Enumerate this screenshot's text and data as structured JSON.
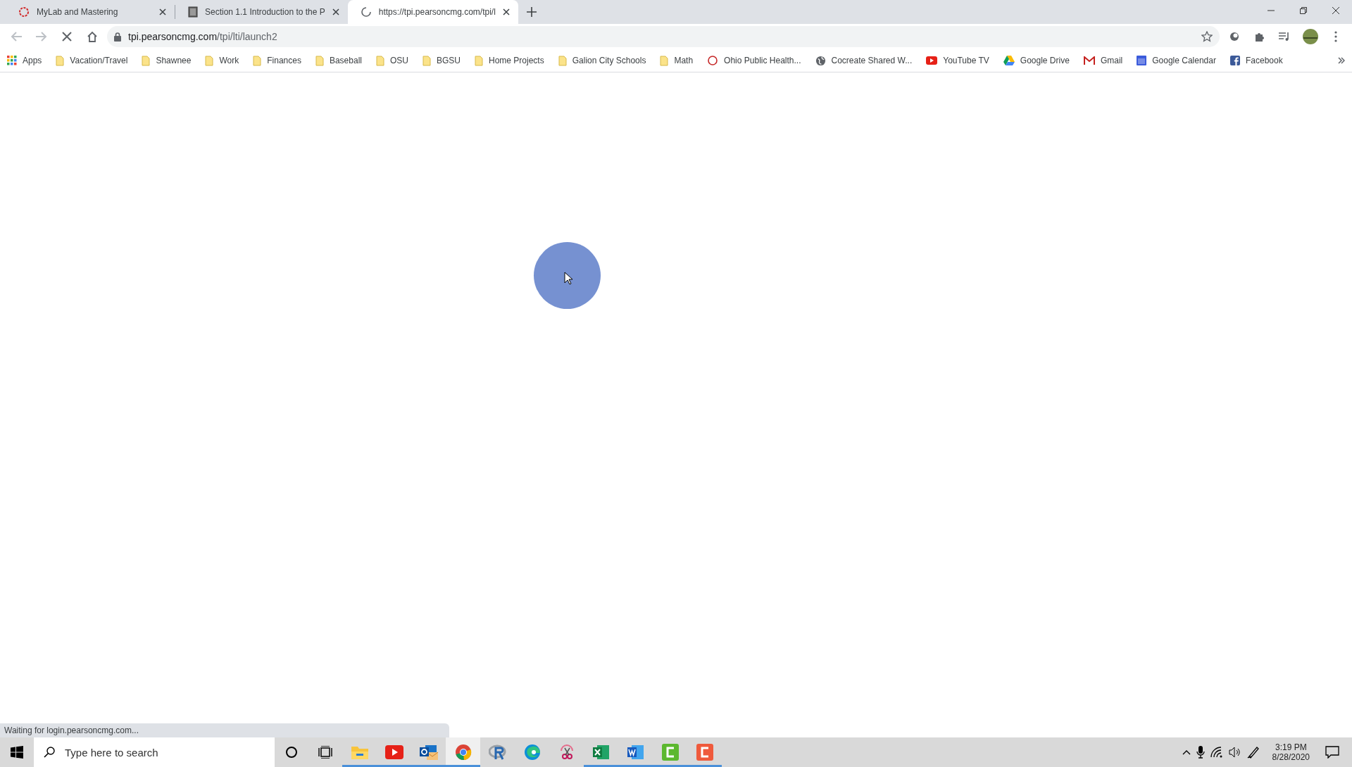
{
  "tabs": [
    {
      "title": "MyLab and Mastering",
      "kind": "ring",
      "selected": false
    },
    {
      "title": "Section 1.1 Introduction to the P",
      "kind": "doc",
      "selected": false
    },
    {
      "title": "https://tpi.pearsoncmg.com/tpi/l",
      "kind": "spinner",
      "selected": true
    }
  ],
  "address": {
    "host": "tpi.pearsoncmg.com",
    "path": "/tpi/lti/launch2"
  },
  "bookmarks": [
    {
      "label": "Apps",
      "kind": "apps"
    },
    {
      "label": "Vacation/Travel",
      "kind": "folder"
    },
    {
      "label": "Shawnee",
      "kind": "folder"
    },
    {
      "label": "Work",
      "kind": "folder"
    },
    {
      "label": "Finances",
      "kind": "folder"
    },
    {
      "label": "Baseball",
      "kind": "folder"
    },
    {
      "label": "OSU",
      "kind": "folder"
    },
    {
      "label": "BGSU",
      "kind": "folder"
    },
    {
      "label": "Home Projects",
      "kind": "folder"
    },
    {
      "label": "Galion City Schools",
      "kind": "folder"
    },
    {
      "label": "Math",
      "kind": "folder"
    },
    {
      "label": "Ohio Public Health...",
      "kind": "ring"
    },
    {
      "label": "Cocreate Shared W...",
      "kind": "globe"
    },
    {
      "label": "YouTube TV",
      "kind": "youtube"
    },
    {
      "label": "Google Drive",
      "kind": "drive"
    },
    {
      "label": "Gmail",
      "kind": "gmail"
    },
    {
      "label": "Google Calendar",
      "kind": "calendar"
    },
    {
      "label": "Facebook",
      "kind": "facebook"
    }
  ],
  "status": "Waiting for login.pearsoncmg.com...",
  "taskbar": {
    "search_placeholder": "Type here to search",
    "apps": [
      {
        "kind": "explorer",
        "running": true,
        "selected": false
      },
      {
        "kind": "youtube",
        "running": true,
        "selected": false
      },
      {
        "kind": "outlook",
        "running": true,
        "selected": false
      },
      {
        "kind": "chrome",
        "running": true,
        "selected": true
      },
      {
        "kind": "r",
        "running": false,
        "selected": false
      },
      {
        "kind": "edge",
        "running": false,
        "selected": false
      },
      {
        "kind": "snip",
        "running": false,
        "selected": false
      },
      {
        "kind": "excel",
        "running": true,
        "selected": false
      },
      {
        "kind": "word",
        "running": true,
        "selected": false
      },
      {
        "kind": "camgreen",
        "running": true,
        "selected": false
      },
      {
        "kind": "camred",
        "running": true,
        "selected": false
      }
    ],
    "time": "3:19 PM",
    "date": "8/28/2020"
  }
}
